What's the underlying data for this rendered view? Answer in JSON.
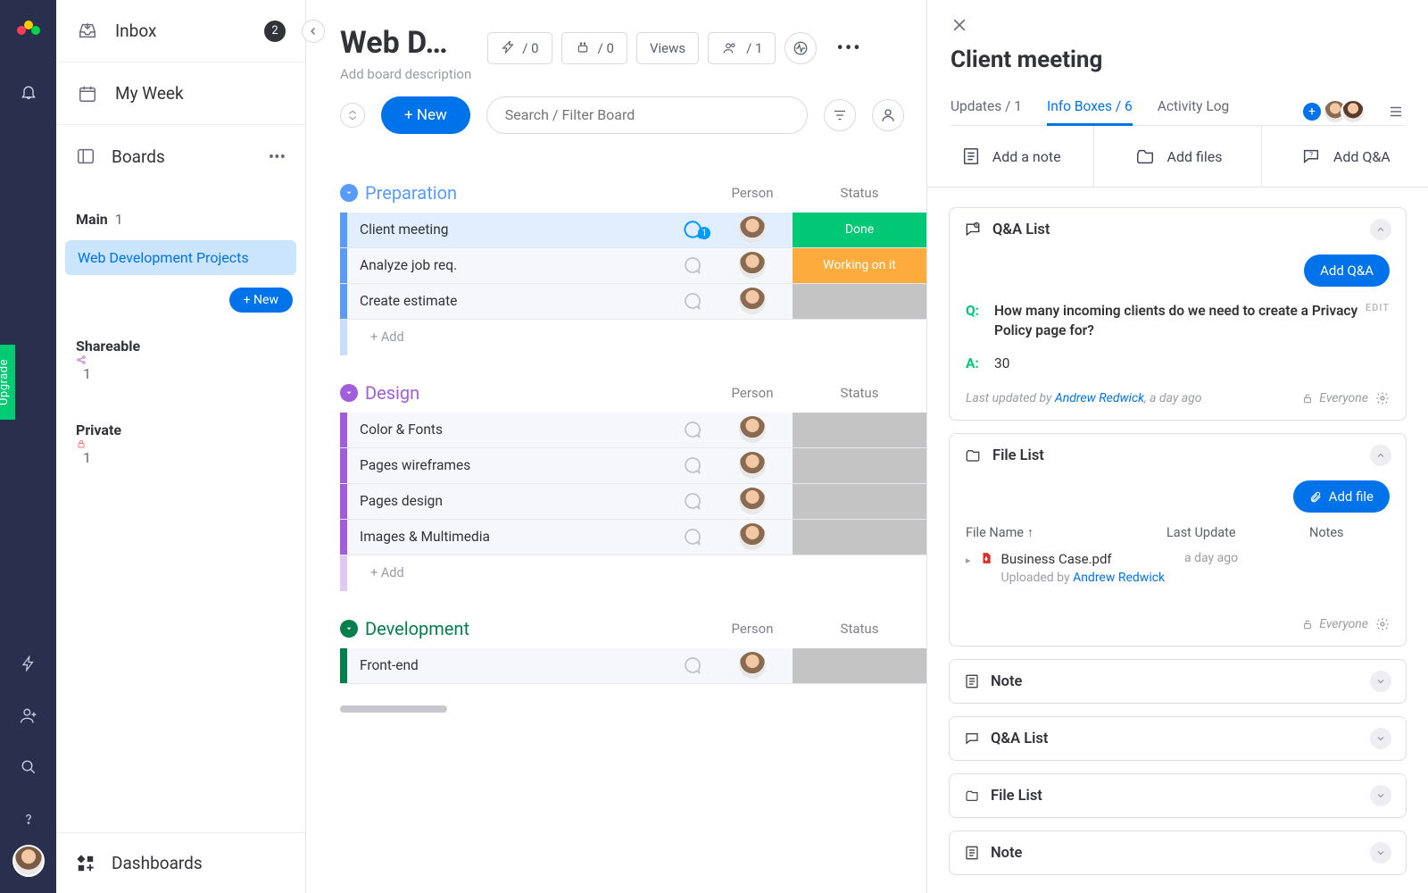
{
  "rail": {
    "upgrade": "Upgrade"
  },
  "nav": {
    "inbox": "Inbox",
    "inbox_count": "2",
    "myweek": "My Week",
    "boards": "Boards",
    "main": {
      "label": "Main",
      "count": "1",
      "board": "Web Development Projects",
      "new": "+ New"
    },
    "shareable": {
      "label": "Shareable",
      "count": "1"
    },
    "private": {
      "label": "Private",
      "count": "1"
    },
    "dashboards": "Dashboards"
  },
  "board": {
    "title": "Web D…",
    "subtitle": "Add board description",
    "chips": {
      "automations": "/ 0",
      "integrations": "/ 0",
      "views": "Views",
      "members": "/ 1"
    },
    "new_btn": "+ New",
    "search_placeholder": "Search / Filter Board",
    "columns": {
      "person": "Person",
      "status": "Status"
    },
    "addrow": "+ Add",
    "groups": [
      {
        "name": "Preparation",
        "color": "#579bfc",
        "items": [
          {
            "name": "Client meeting",
            "status": "Done",
            "status_color": "#00c875",
            "selected": true,
            "chat": 1
          },
          {
            "name": "Analyze job req.",
            "status": "Working on it",
            "status_color": "#fdab3d"
          },
          {
            "name": "Create estimate",
            "status": "",
            "status_color": "#c4c4c4"
          }
        ]
      },
      {
        "name": "Design",
        "color": "#a25ddc",
        "items": [
          {
            "name": "Color & Fonts",
            "status": "",
            "status_color": "#c4c4c4"
          },
          {
            "name": "Pages wireframes",
            "status": "",
            "status_color": "#c4c4c4"
          },
          {
            "name": "Pages design",
            "status": "",
            "status_color": "#c4c4c4"
          },
          {
            "name": "Images & Multimedia",
            "status": "",
            "status_color": "#c4c4c4"
          }
        ]
      },
      {
        "name": "Development",
        "color": "#037f4c",
        "items": [
          {
            "name": "Front-end",
            "status": "",
            "status_color": "#c4c4c4"
          }
        ]
      }
    ]
  },
  "panel": {
    "title": "Client meeting",
    "tabs": {
      "updates": "Updates / 1",
      "info": "Info Boxes / 6",
      "activity": "Activity Log"
    },
    "actions": {
      "note": "Add a note",
      "files": "Add files",
      "qa": "Add Q&A"
    },
    "qa_card": {
      "title": "Q&A List",
      "add": "Add Q&A",
      "q_label": "Q:",
      "a_label": "A:",
      "question": "How many incoming clients do we need to create a Privacy Policy page for?",
      "answer": "30",
      "edit": "EDIT",
      "updated_prefix": "Last updated by",
      "updated_by": "Andrew Redwick",
      "updated_when": ", a day ago",
      "visibility": "Everyone"
    },
    "file_card": {
      "title": "File List",
      "add": "Add file",
      "cols": {
        "name": "File Name ↑",
        "updated": "Last Update",
        "notes": "Notes"
      },
      "file": {
        "name": "Business Case.pdf",
        "when": "a day ago",
        "uploaded_prefix": "Uploaded by",
        "by": "Andrew Redwick"
      },
      "visibility": "Everyone"
    },
    "collapsed": [
      "Note",
      "Q&A List",
      "File List",
      "Note"
    ]
  }
}
